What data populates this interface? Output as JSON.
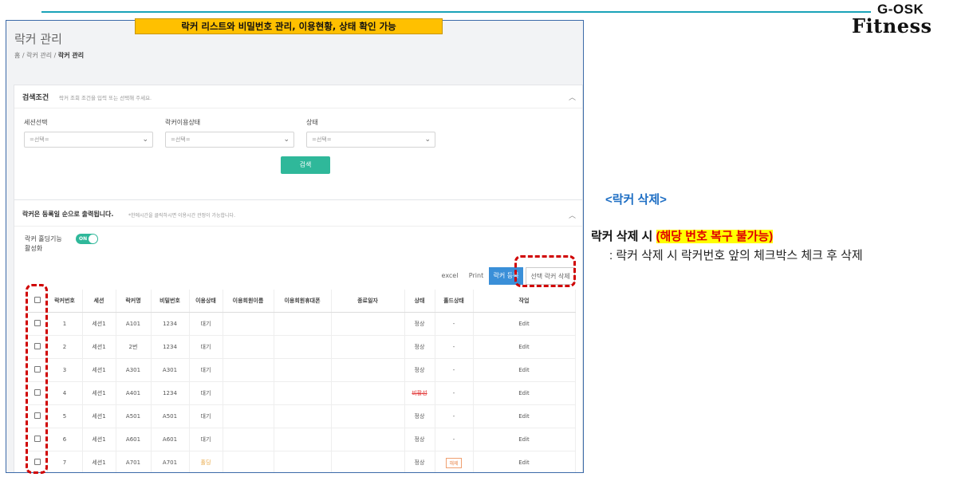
{
  "brand": {
    "top": "G-OSK",
    "bottom": "Fitness"
  },
  "highlight_note": "락커 리스트와 비밀번호 관리, 이용현황, 상태 확인 가능",
  "page": {
    "title": "락커 관리",
    "breadcrumb": [
      "홈",
      "락커 관리",
      "락커 관리"
    ]
  },
  "search_panel": {
    "title": "검색조건",
    "subtitle": "락커 조회 조건을 입력 또는 선택해 주세요.",
    "fields": [
      {
        "label": "세션선택",
        "value": "=선택="
      },
      {
        "label": "락커이용상태",
        "value": "=선택="
      },
      {
        "label": "상태",
        "value": "=선택="
      }
    ],
    "search_button": "검색"
  },
  "list_panel": {
    "title": "락커은 등록일 순으로 출력됩니다.",
    "subtitle": "*한에시간을 클릭하시면 이용시간 관정이 가능합니다.",
    "hold_label_1": "락커 홀딩기능",
    "hold_label_2": "활성화",
    "hold_toggle": "ON",
    "toolbar": {
      "excel": "excel",
      "print": "Print",
      "register": "락커 등록",
      "delete_selected": "선택 락커 삭제"
    },
    "columns": [
      "",
      "락커번호",
      "세션",
      "락커명",
      "비밀번호",
      "이용상태",
      "이용회원이름",
      "이용회원휴대폰",
      "종료일자",
      "상태",
      "홀드상태",
      "작업"
    ],
    "rows": [
      {
        "no": "1",
        "session": "세션1",
        "name": "A101",
        "pw": "1234",
        "use": "대기",
        "member": "",
        "phone": "",
        "end": "",
        "status": "정상",
        "hold": "-",
        "action": "Edit"
      },
      {
        "no": "2",
        "session": "세션1",
        "name": "2번",
        "pw": "1234",
        "use": "대기",
        "member": "",
        "phone": "",
        "end": "",
        "status": "정상",
        "hold": "-",
        "action": "Edit"
      },
      {
        "no": "3",
        "session": "세션1",
        "name": "A301",
        "pw": "A301",
        "use": "대기",
        "member": "",
        "phone": "",
        "end": "",
        "status": "정상",
        "hold": "-",
        "action": "Edit"
      },
      {
        "no": "4",
        "session": "세션1",
        "name": "A401",
        "pw": "1234",
        "use": "대기",
        "member": "",
        "phone": "",
        "end": "",
        "status": "비활성",
        "hold": "-",
        "action": "Edit"
      },
      {
        "no": "5",
        "session": "세션1",
        "name": "A501",
        "pw": "A501",
        "use": "대기",
        "member": "",
        "phone": "",
        "end": "",
        "status": "정상",
        "hold": "-",
        "action": "Edit"
      },
      {
        "no": "6",
        "session": "세션1",
        "name": "A601",
        "pw": "A601",
        "use": "대기",
        "member": "",
        "phone": "",
        "end": "",
        "status": "정상",
        "hold": "-",
        "action": "Edit"
      },
      {
        "no": "7",
        "session": "세션1",
        "name": "A701",
        "pw": "A701",
        "use": "홀딩",
        "member": "",
        "phone": "",
        "end": "",
        "status": "정상",
        "hold": "해제",
        "action": "Edit"
      }
    ]
  },
  "annotation": {
    "title": "<락커 삭제>",
    "line1_prefix": "락커 삭제 시 ",
    "line1_warning": "(해당 번호 복구 불가능)",
    "line2": ": 락커 삭제 시 락커번호 앞의 체크박스 체크 후 삭제"
  },
  "colors": {
    "accent": "#2fb89a",
    "primary": "#3a8fd8",
    "warning": "#e00000",
    "highlight": "#ffc000",
    "topline": "#1aa3b8"
  }
}
